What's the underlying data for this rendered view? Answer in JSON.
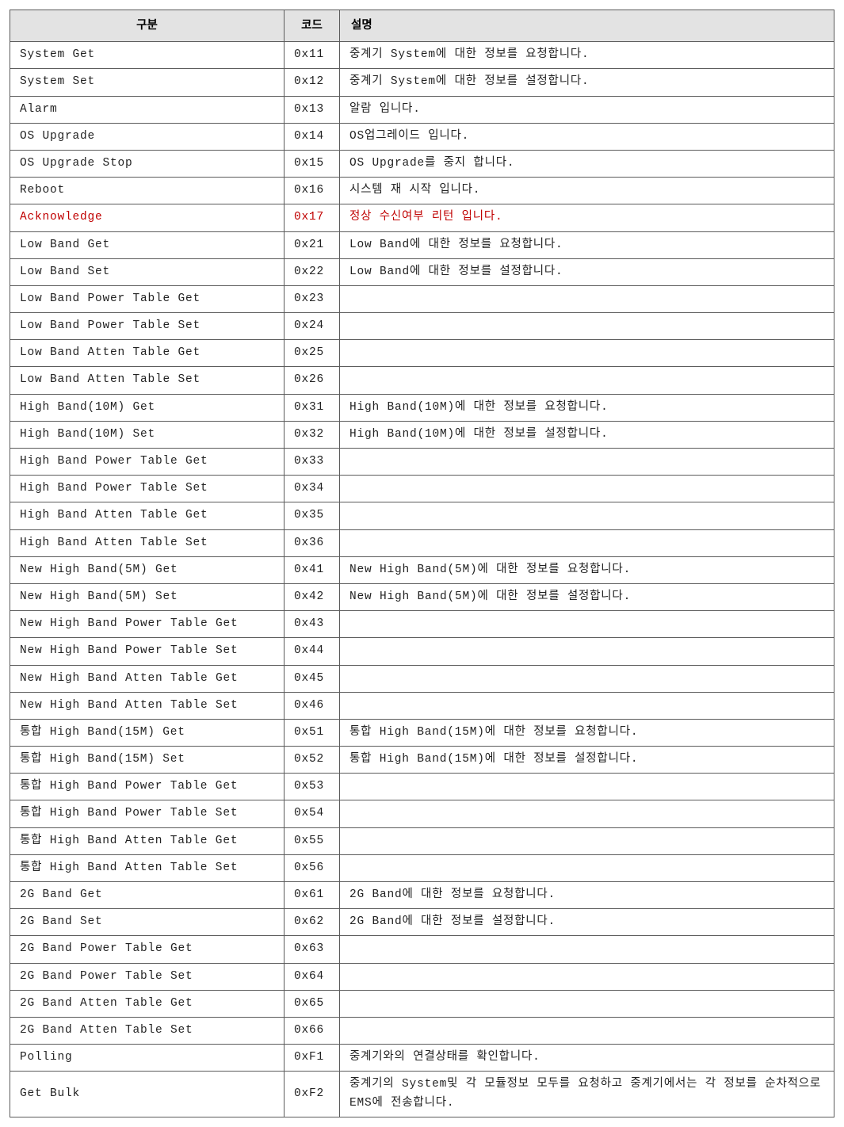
{
  "table": {
    "headers": {
      "gubun": "구분",
      "code": "코드",
      "desc": "설명"
    },
    "rows": [
      {
        "gubun": "System Get",
        "code": "0x11",
        "desc": "중계기 System에 대한 정보를 요청합니다.",
        "highlight": false
      },
      {
        "gubun": "System Set",
        "code": "0x12",
        "desc": "중계기 System에 대한 정보를 설정합니다.",
        "highlight": false
      },
      {
        "gubun": "Alarm",
        "code": "0x13",
        "desc": "알람 입니다.",
        "highlight": false
      },
      {
        "gubun": "OS Upgrade",
        "code": "0x14",
        "desc": "OS업그레이드 입니다.",
        "highlight": false
      },
      {
        "gubun": "OS Upgrade Stop",
        "code": "0x15",
        "desc": "OS Upgrade를 중지 합니다.",
        "highlight": false
      },
      {
        "gubun": "Reboot",
        "code": "0x16",
        "desc": "시스템 재 시작 입니다.",
        "highlight": false
      },
      {
        "gubun": "Acknowledge",
        "code": "0x17",
        "desc": "정상 수신여부 리턴 입니다.",
        "highlight": true
      },
      {
        "gubun": "Low Band Get",
        "code": "0x21",
        "desc": "Low Band에 대한 정보를 요청합니다.",
        "highlight": false
      },
      {
        "gubun": "Low Band Set",
        "code": "0x22",
        "desc": "Low Band에 대한 정보를 설정합니다.",
        "highlight": false
      },
      {
        "gubun": "Low Band Power Table Get",
        "code": "0x23",
        "desc": "",
        "highlight": false
      },
      {
        "gubun": "Low Band Power Table Set",
        "code": "0x24",
        "desc": "",
        "highlight": false
      },
      {
        "gubun": "Low Band Atten Table Get",
        "code": "0x25",
        "desc": "",
        "highlight": false
      },
      {
        "gubun": "Low Band Atten Table Set",
        "code": "0x26",
        "desc": "",
        "highlight": false
      },
      {
        "gubun": "High Band(10M) Get",
        "code": "0x31",
        "desc": "High Band(10M)에 대한 정보를 요청합니다.",
        "highlight": false
      },
      {
        "gubun": "High Band(10M) Set",
        "code": "0x32",
        "desc": "High Band(10M)에 대한 정보를 설정합니다.",
        "highlight": false
      },
      {
        "gubun": "High Band Power Table Get",
        "code": "0x33",
        "desc": "",
        "highlight": false
      },
      {
        "gubun": "High Band Power Table Set",
        "code": "0x34",
        "desc": "",
        "highlight": false
      },
      {
        "gubun": "High Band Atten Table Get",
        "code": "0x35",
        "desc": "",
        "highlight": false
      },
      {
        "gubun": "High Band Atten Table Set",
        "code": "0x36",
        "desc": "",
        "highlight": false
      },
      {
        "gubun": "New High Band(5M) Get",
        "code": "0x41",
        "desc": "New High Band(5M)에 대한 정보를 요청합니다.",
        "highlight": false
      },
      {
        "gubun": "New High Band(5M) Set",
        "code": "0x42",
        "desc": "New High Band(5M)에 대한 정보를 설정합니다.",
        "highlight": false
      },
      {
        "gubun": "New High Band Power Table Get",
        "code": "0x43",
        "desc": "",
        "highlight": false
      },
      {
        "gubun": "New High Band Power Table Set",
        "code": "0x44",
        "desc": "",
        "highlight": false
      },
      {
        "gubun": "New High Band Atten Table Get",
        "code": "0x45",
        "desc": "",
        "highlight": false
      },
      {
        "gubun": "New High Band Atten Table Set",
        "code": "0x46",
        "desc": "",
        "highlight": false
      },
      {
        "gubun": "통합 High Band(15M) Get",
        "code": "0x51",
        "desc": "통합 High Band(15M)에 대한 정보를 요청합니다.",
        "highlight": false
      },
      {
        "gubun": "통합 High Band(15M) Set",
        "code": "0x52",
        "desc": "통합 High Band(15M)에 대한 정보를 설정합니다.",
        "highlight": false
      },
      {
        "gubun": "통합 High Band Power Table Get",
        "code": "0x53",
        "desc": "",
        "highlight": false
      },
      {
        "gubun": "통합 High Band Power Table Set",
        "code": "0x54",
        "desc": "",
        "highlight": false
      },
      {
        "gubun": "통합 High Band Atten Table Get",
        "code": "0x55",
        "desc": "",
        "highlight": false
      },
      {
        "gubun": "통합 High Band Atten Table Set",
        "code": "0x56",
        "desc": "",
        "highlight": false
      },
      {
        "gubun": "2G Band Get",
        "code": "0x61",
        "desc": "2G Band에 대한 정보를 요청합니다.",
        "highlight": false
      },
      {
        "gubun": "2G Band Set",
        "code": "0x62",
        "desc": "2G Band에 대한 정보를 설정합니다.",
        "highlight": false
      },
      {
        "gubun": "2G Band Power Table Get",
        "code": "0x63",
        "desc": "",
        "highlight": false
      },
      {
        "gubun": "2G Band Power Table Set",
        "code": "0x64",
        "desc": "",
        "highlight": false
      },
      {
        "gubun": "2G Band Atten Table Get",
        "code": "0x65",
        "desc": "",
        "highlight": false
      },
      {
        "gubun": "2G Band Atten Table Set",
        "code": "0x66",
        "desc": "",
        "highlight": false
      },
      {
        "gubun": "Polling",
        "code": "0xF1",
        "desc": "중계기와의 연결상태를 확인합니다.",
        "highlight": false
      },
      {
        "gubun": "Get Bulk",
        "code": "0xF2",
        "desc": "중계기의 System및 각 모듈정보 모두를 요청하고 중계기에서는 각 정보를 순차적으로 EMS에 전송합니다.",
        "highlight": false
      }
    ]
  }
}
